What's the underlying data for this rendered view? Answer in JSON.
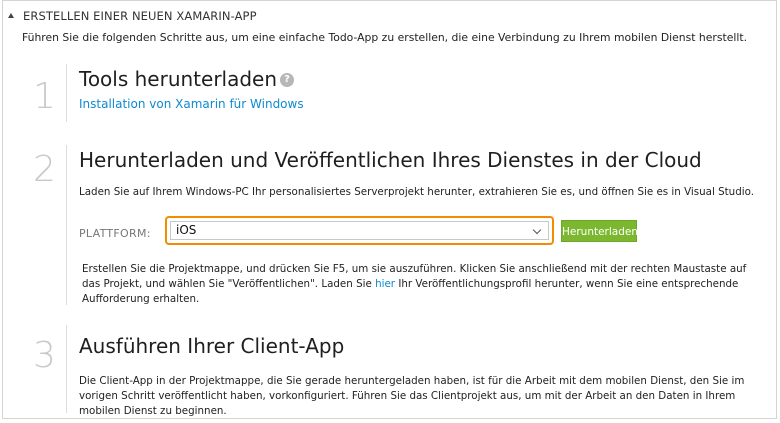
{
  "header": {
    "title": "ERSTELLEN EINER NEUEN XAMARIN-APP",
    "intro": "Führen Sie die folgenden Schritte aus, um eine einfache Todo-App zu erstellen, die eine Verbindung zu Ihrem mobilen Dienst herstellt."
  },
  "steps": [
    {
      "number": "1",
      "title": "Tools herunterladen",
      "help_icon": "?",
      "link": "Installation von Xamarin für Windows"
    },
    {
      "number": "2",
      "title": "Herunterladen und Veröffentlichen Ihres Dienstes in der Cloud",
      "description": "Laden Sie auf Ihrem Windows-PC Ihr personalisiertes Serverprojekt herunter, extrahieren Sie es, und öffnen Sie es in Visual Studio.",
      "platform_label": "PLATTFORM:",
      "platform_value": "iOS",
      "download_button": "Herunterladen",
      "instructions_before": "Erstellen Sie die Projektmappe, und drücken Sie F5, um sie auszuführen. Klicken Sie anschließend mit der rechten Maustaste auf das Projekt, und wählen Sie \"Veröffentlichen\". Laden Sie ",
      "instructions_link": "hier",
      "instructions_after": " Ihr Veröffentlichungsprofil herunter, wenn Sie eine entsprechende Aufforderung erhalten."
    },
    {
      "number": "3",
      "title": "Ausführen Ihrer Client-App",
      "description": "Die Client-App in der Projektmappe, die Sie gerade heruntergeladen haben, ist für die Arbeit mit dem mobilen Dienst, den Sie im vorigen Schritt veröffentlicht haben, vorkonfiguriert. Führen Sie das Clientprojekt aus, um mit der Arbeit an den Daten in Ihrem mobilen Dienst zu beginnen."
    }
  ],
  "colors": {
    "link": "#0d8ad0",
    "accent_border": "#f28c00",
    "button": "#7cb82f",
    "step_number": "#c9c9c9"
  }
}
